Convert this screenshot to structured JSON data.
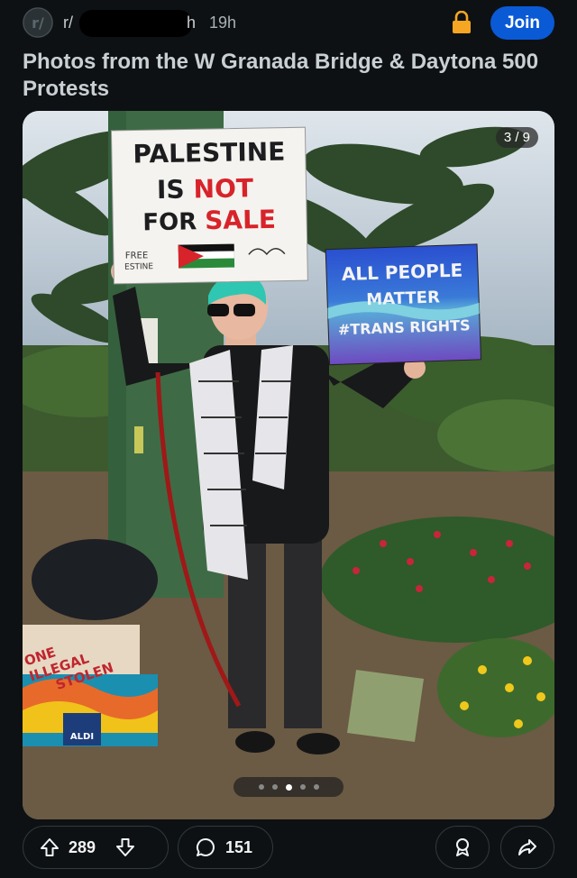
{
  "header": {
    "subreddit_prefix": "r/",
    "subreddit_tail": "h",
    "time_ago": "19h",
    "join_label": "Join"
  },
  "post": {
    "title": "Photos from the W Granada Bridge & Daytona 500 Protests",
    "image_counter": "3 / 9",
    "current_image": 3,
    "total_images": 9
  },
  "signs": {
    "left": {
      "line1": "PALESTINE",
      "line2_prefix": "IS",
      "line2_accent": "NOT",
      "line3_prefix": "FOR",
      "line3_accent": "SALE",
      "small_left": "FREE",
      "small_left_2": "ESTINE"
    },
    "right": {
      "line1": "ALL PEOPLE",
      "line2": "MATTER",
      "line3": "#TRANS RIGHTS"
    },
    "bag": {
      "line1": "ONE",
      "line2": "ILLEGAL",
      "line3": "STOLEN",
      "brand": "ALDI"
    }
  },
  "actions": {
    "vote_count": "289",
    "comment_count": "151"
  },
  "icons": {
    "avatar": "subreddit-avatar-icon",
    "lock": "lock-icon",
    "upvote": "upvote-arrow-icon",
    "downvote": "downvote-arrow-icon",
    "comment": "comment-bubble-icon",
    "award": "award-icon",
    "share": "share-arrow-icon"
  },
  "colors": {
    "background": "#0e1113",
    "join": "#0a5ad6",
    "lock": "#f5a623",
    "sign_red": "#d8232a"
  }
}
